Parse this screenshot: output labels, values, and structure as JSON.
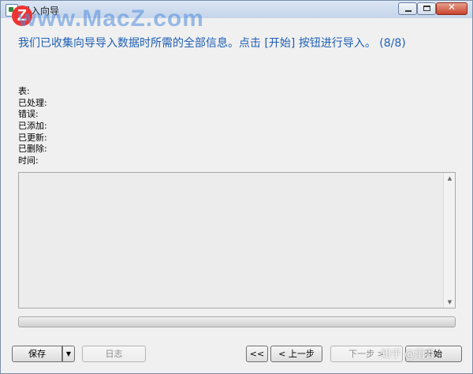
{
  "window": {
    "title": "导入向导",
    "watermark": "www.MacZ.com",
    "watermark_badge": "Z"
  },
  "heading": "我们已收集向导导入数据时所需的全部信息。点击 [开始] 按钮进行导入。 (8/8)",
  "stats": [
    {
      "label": "表:"
    },
    {
      "label": "已处理:"
    },
    {
      "label": "错误:"
    },
    {
      "label": "已添加:"
    },
    {
      "label": "已更新:"
    },
    {
      "label": "已删除:"
    },
    {
      "label": "时间:"
    }
  ],
  "log": {
    "text": ""
  },
  "progress": {
    "value": 0
  },
  "buttons": {
    "save": "保存",
    "log": "日志",
    "first": "<<",
    "prev": "< 上一步",
    "next": "下一步 >",
    "start": "开始"
  },
  "overlay": {
    "zhihu": "知乎 @雨鑫"
  },
  "icons": {
    "min": "minimize-icon",
    "max": "maximize-icon",
    "close": "close-icon",
    "dropdown": "dropdown-arrow-icon"
  },
  "colors": {
    "heading": "#1f5fb4",
    "close": "#c7432b"
  }
}
